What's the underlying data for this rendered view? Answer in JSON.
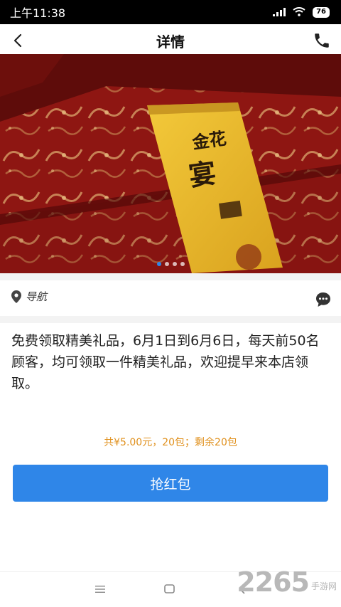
{
  "status_bar": {
    "time": "上午11:38",
    "battery": "76",
    "icons": [
      "signal-icon",
      "wifi-icon",
      "battery-icon"
    ]
  },
  "header": {
    "title": "详情",
    "back_icon": "chevron-left-icon",
    "phone_icon": "phone-icon"
  },
  "banner": {
    "slides": 4,
    "active_slide": 1,
    "product_label": "金花 宴"
  },
  "navigation": {
    "label": "导航",
    "location_icon": "location-pin-icon",
    "chat_icon": "chat-bubble-icon"
  },
  "content": {
    "description": "免费领取精美礼品，6月1日到6月6日，每天前50名顾客，均可领取一件精美礼品，欢迎提早来本店领取。",
    "summary": "共¥5.00元，20包；剩余20包"
  },
  "actions": {
    "grab_label": "抢红包"
  },
  "system_nav": {
    "items": [
      "menu-icon",
      "home-icon",
      "back-icon"
    ]
  },
  "watermark": {
    "number": "2265",
    "site_label": "手游网"
  },
  "colors": {
    "accent_blue": "#2f86e8",
    "summary_orange": "#e0901c",
    "status_bar_bg": "#000000"
  }
}
